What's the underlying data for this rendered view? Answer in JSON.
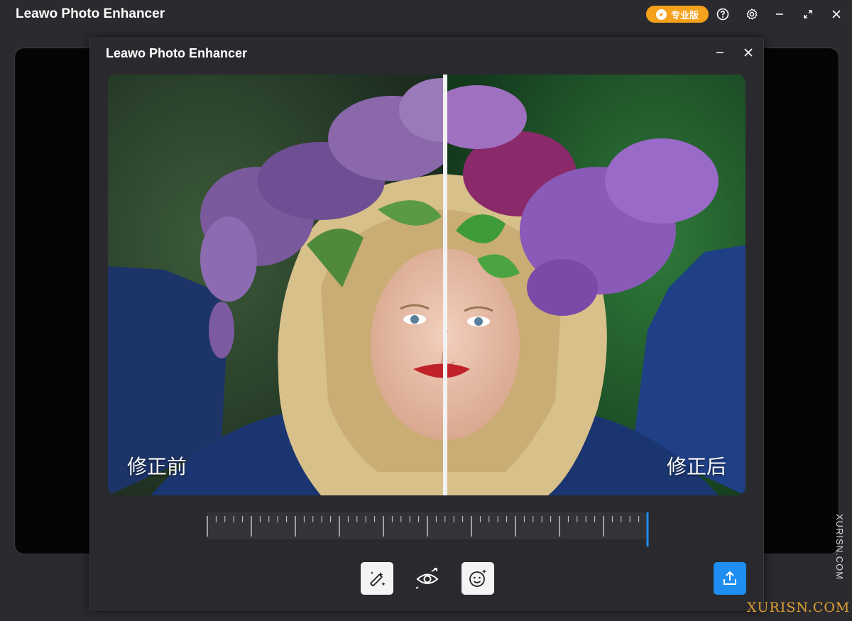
{
  "app": {
    "title": "Leawo Photo Enhancer",
    "pro_badge": "专业版",
    "accent": "#1e8ef0",
    "badge_color": "#f5a11c"
  },
  "window_controls": [
    "help-icon",
    "settings-icon",
    "minimize-icon",
    "maximize-icon",
    "close-icon"
  ],
  "dialog": {
    "title": "Leawo Photo Enhancer",
    "controls": [
      "minimize-icon",
      "close-icon"
    ]
  },
  "compare": {
    "before_label": "修正前",
    "after_label": "修正后",
    "divider_position_fraction": 0.53
  },
  "slider": {
    "value_fraction": 1.0
  },
  "toolbar": {
    "items": [
      "magic-enhance-icon",
      "eye-compare-icon",
      "face-enhance-icon",
      "export-icon"
    ]
  },
  "watermark": {
    "vertical": "XURISN.COM",
    "horizontal": "XURISN.COM"
  }
}
